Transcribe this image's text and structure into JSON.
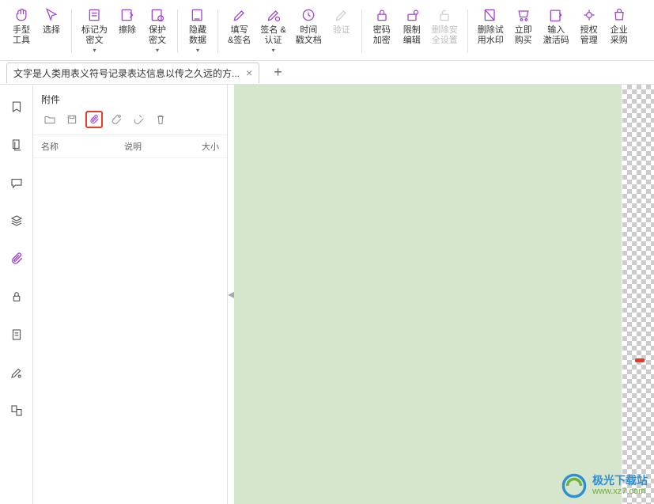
{
  "ribbon": {
    "hand": "手型\n工具",
    "select": "选择",
    "markConfidential": "标记为\n密文",
    "erase": "擦除",
    "protectConfidential": "保护\n密文",
    "hideData": "隐藏\n数据",
    "fillSign": "填写\n&签名",
    "signCert": "签名 &\n认证",
    "timestamp": "时间\n戳文档",
    "verify": "验证",
    "pwdEncrypt": "密码\n加密",
    "restrictEdit": "限制\n编辑",
    "removeSecurity": "删除安\n全设置",
    "removeWatermark": "删除试\n用水印",
    "buyNow": "立即\n购买",
    "inputCode": "输入\n激活码",
    "authMgmt": "授权\n管理",
    "enterprise": "企业\n采购"
  },
  "tab": {
    "title": "文字是人类用表义符号记录表达信息以传之久远的方..."
  },
  "panel": {
    "title": "附件",
    "columns": {
      "name": "名称",
      "desc": "说明",
      "size": "大小"
    }
  },
  "watermark": {
    "cn": "极光下载站",
    "url": "www.xz7.com"
  }
}
